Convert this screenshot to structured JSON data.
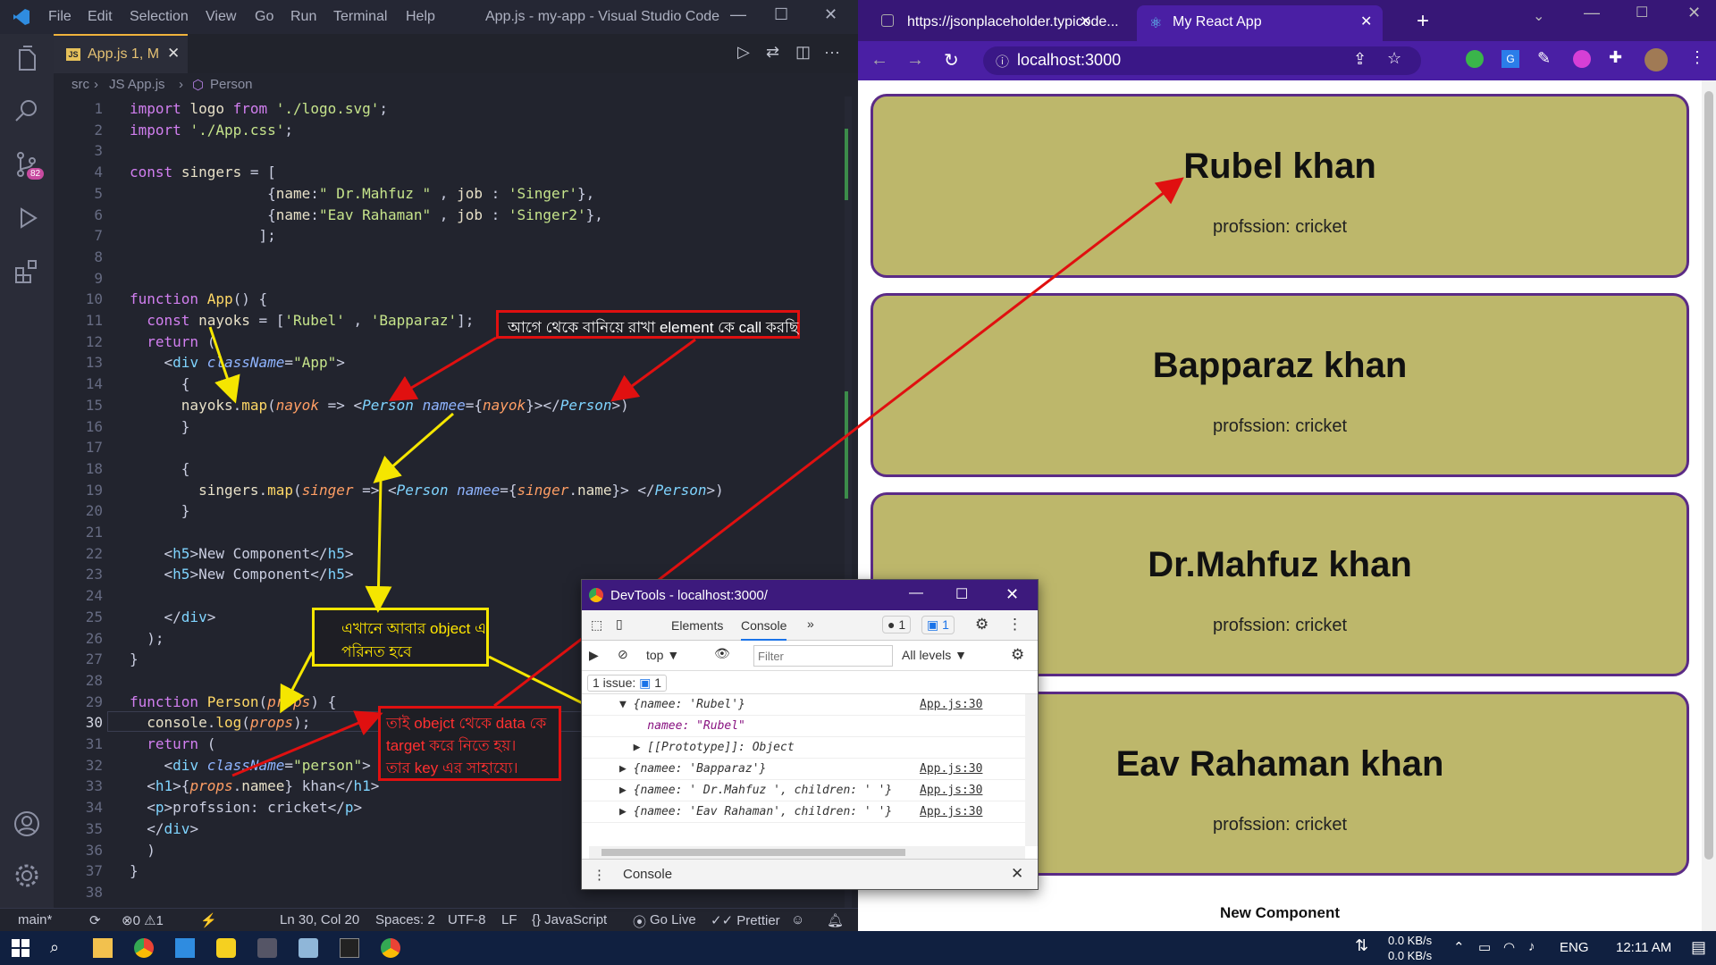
{
  "vscode": {
    "menu": [
      "File",
      "Edit",
      "Selection",
      "View",
      "Go",
      "Run",
      "Terminal",
      "Help"
    ],
    "window_title": "App.js - my-app - Visual Studio Code",
    "tab_label": "App.js 1, M",
    "breadcrumb": [
      "src",
      "JS App.js",
      "Person"
    ],
    "scm_badge": "82",
    "lines": [
      {
        "n": "1",
        "html": "<span class='kw'>import</span> <span class='var'>logo</span> <span class='kw'>from</span> <span class='str'>'./logo.svg'</span>;"
      },
      {
        "n": "2",
        "html": "<span class='kw'>import</span> <span class='str'>'./App.css'</span>;"
      },
      {
        "n": "3",
        "html": ""
      },
      {
        "n": "4",
        "html": "<span class='kw'>const</span> <span class='var'>singers</span> = ["
      },
      {
        "n": "5",
        "html": "                {<span class='var'>name</span>:<span class='str'>\" Dr.Mahfuz \"</span> , <span class='var'>job</span> : <span class='str'>'Singer'</span>},"
      },
      {
        "n": "6",
        "html": "                {<span class='var'>name</span>:<span class='str'>\"Eav Rahaman\"</span> , <span class='var'>job</span> : <span class='str'>'Singer2'</span>},"
      },
      {
        "n": "7",
        "html": "               ];"
      },
      {
        "n": "8",
        "html": ""
      },
      {
        "n": "9",
        "html": ""
      },
      {
        "n": "10",
        "html": "<span class='kw'>function</span> <span class='fn'>App</span>() {"
      },
      {
        "n": "11",
        "html": "  <span class='kw'>const</span> <span class='var'>nayoks</span> = [<span class='str'>'Rubel'</span> , <span class='str'>'Bapparaz'</span>];"
      },
      {
        "n": "12",
        "html": "  <span class='kw'>return</span> ("
      },
      {
        "n": "13",
        "html": "    &lt;<span class='tag'>div</span> <span class='attr'>className</span>=<span class='str'>\"App\"</span>&gt;"
      },
      {
        "n": "14",
        "html": "      {"
      },
      {
        "n": "15",
        "html": "      <span class='var'>nayoks</span>.<span class='fn'>map</span>(<span class='prm'>nayok</span> =&gt; &lt;<span class='tag' style='font-style:italic'>Person</span> <span class='attr'>namee</span>={<span class='prm'>nayok</span>}&gt;&lt;/<span class='tag' style='font-style:italic'>Person</span>&gt;)"
      },
      {
        "n": "16",
        "html": "      }"
      },
      {
        "n": "17",
        "html": ""
      },
      {
        "n": "18",
        "html": "      {"
      },
      {
        "n": "19",
        "html": "        <span class='var'>singers</span>.<span class='fn'>map</span>(<span class='prm'>singer</span> =&gt; &lt;<span class='tag' style='font-style:italic'>Person</span> <span class='attr'>namee</span>={<span class='prm'>singer</span>.<span class='var'>name</span>}&gt; &lt;/<span class='tag' style='font-style:italic'>Person</span>&gt;)"
      },
      {
        "n": "20",
        "html": "      }"
      },
      {
        "n": "21",
        "html": ""
      },
      {
        "n": "22",
        "html": "    &lt;<span class='tag'>h5</span>&gt;New Component&lt;/<span class='tag'>h5</span>&gt;"
      },
      {
        "n": "23",
        "html": "    &lt;<span class='tag'>h5</span>&gt;New Component&lt;/<span class='tag'>h5</span>&gt;"
      },
      {
        "n": "24",
        "html": ""
      },
      {
        "n": "25",
        "html": "    &lt;/<span class='tag'>div</span>&gt;"
      },
      {
        "n": "26",
        "html": "  );"
      },
      {
        "n": "27",
        "html": "}"
      },
      {
        "n": "28",
        "html": ""
      },
      {
        "n": "29",
        "html": "<span class='kw'>function</span> <span class='fn'>Person</span>(<span class='prm'>props</span>) {"
      },
      {
        "n": "30",
        "html": "  <span class='var'>console</span>.<span class='fn'>log</span>(<span class='prm'>props</span>);"
      },
      {
        "n": "31",
        "html": "  <span class='kw'>return</span> ("
      },
      {
        "n": "32",
        "html": "    &lt;<span class='tag'>div</span> <span class='attr'>className</span>=<span class='str'>\"person\"</span>&gt;"
      },
      {
        "n": "33",
        "html": "  &lt;<span class='tag'>h1</span>&gt;{<span class='prm'>props</span>.<span class='var'>namee</span>} khan&lt;/<span class='tag'>h1</span>&gt;"
      },
      {
        "n": "34",
        "html": "  &lt;<span class='tag'>p</span>&gt;profssion: cricket&lt;/<span class='tag'>p</span>&gt;"
      },
      {
        "n": "35",
        "html": "  &lt;/<span class='tag'>div</span>&gt;"
      },
      {
        "n": "36",
        "html": "  )"
      },
      {
        "n": "37",
        "html": "}"
      },
      {
        "n": "38",
        "html": ""
      }
    ],
    "status": {
      "branch": "main*",
      "problems": "⊗0 ⚠1",
      "position": "Ln 30, Col 20",
      "spaces": "Spaces: 2",
      "encoding": "UTF-8",
      "eol": "LF",
      "language": "{} JavaScript",
      "golive": "Go Live",
      "prettier": "✓✓ Prettier"
    }
  },
  "annotations": {
    "a1": "আগে থেকে বানিয়ে রাখা element কে call করছি",
    "a2_l1": "এখানে আবার object এ",
    "a2_l2": "পরিনত হবে",
    "a3_l1": "তাই obejct থেকে data কে",
    "a3_l2": "target করে নিতে হয়।",
    "a3_l3": "তার key এর সাহায্যে।"
  },
  "chrome": {
    "tab1": "https://jsonplaceholder.typicode...",
    "tab2": "My React App",
    "url": "localhost:3000",
    "cards": [
      {
        "name": "Rubel khan",
        "job": "profssion: cricket"
      },
      {
        "name": "Bapparaz khan",
        "job": "profssion: cricket"
      },
      {
        "name": "Dr.Mahfuz khan",
        "job": "profssion: cricket"
      },
      {
        "name": "Eav Rahaman khan",
        "job": "profssion: cricket"
      }
    ],
    "footer": "New Component"
  },
  "devtools": {
    "title": "DevTools - localhost:3000/",
    "tabs": [
      "Elements",
      "Console"
    ],
    "errors": "1",
    "messages": "1",
    "context": "top ▼",
    "filter_placeholder": "Filter",
    "levels": "All levels ▼",
    "issue": "1 issue: ",
    "issue_count": "1",
    "logs": [
      {
        "text": "▼ {namee: 'Rubel'}",
        "src": "App.js:30"
      },
      {
        "text": "    namee: \"Rubel\"",
        "src": ""
      },
      {
        "text": "  ▶ [[Prototype]]: Object",
        "src": ""
      },
      {
        "text": "▶ {namee: 'Bapparaz'}",
        "src": "App.js:30"
      },
      {
        "text": "▶ {namee: ' Dr.Mahfuz ', children: ' '}",
        "src": "App.js:30"
      },
      {
        "text": "▶ {namee: 'Eav Rahaman', children: ' '}",
        "src": "App.js:30"
      }
    ],
    "drawer": "Console"
  },
  "taskbar": {
    "net_up": "0.0 KB/s",
    "net_down": "0.0 KB/s",
    "lang": "ENG",
    "time": "12:11 AM"
  },
  "colors": {
    "card_bg": "#bdb76b",
    "card_border": "#5b2b86",
    "chrome_frame": "#371777",
    "arrow_red": "#e01010",
    "arrow_yellow": "#f5e600"
  }
}
